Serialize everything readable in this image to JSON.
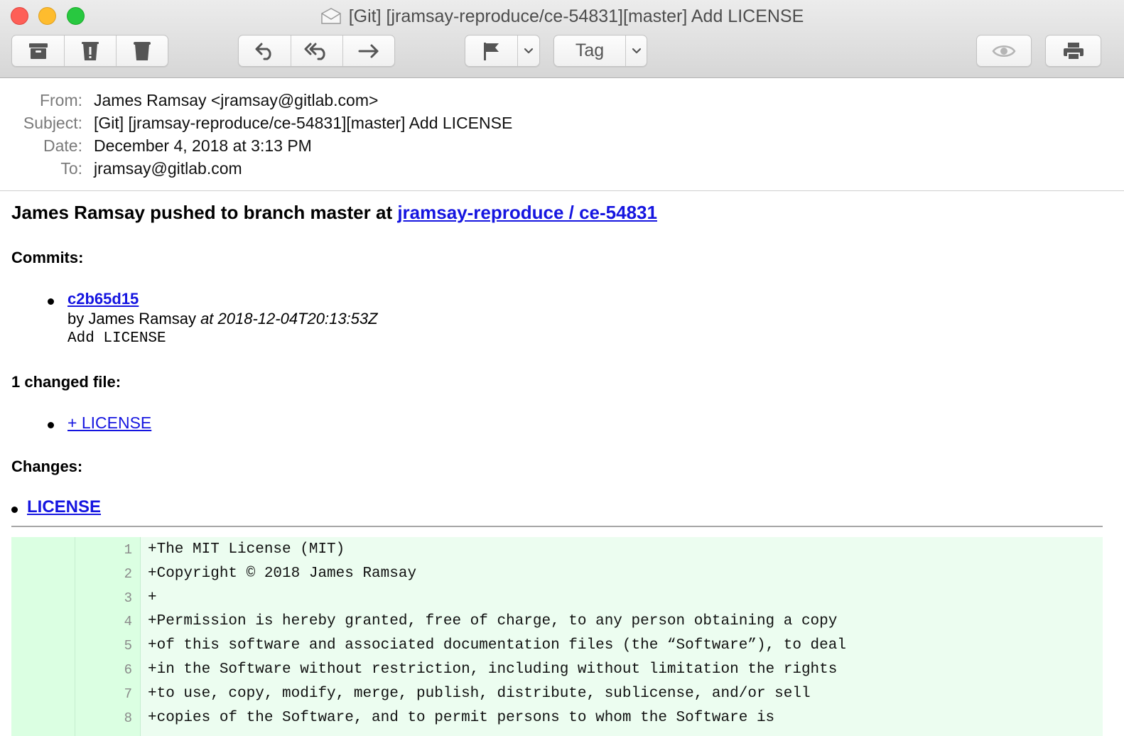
{
  "window": {
    "title": "[Git] [jramsay-reproduce/ce-54831][master] Add LICENSE"
  },
  "toolbar": {
    "tag_label": "Tag",
    "buttons": [
      "archive-icon",
      "junk-icon",
      "trash-icon",
      "reply-icon",
      "reply-all-icon",
      "forward-icon",
      "flag-icon",
      "chevron-down-icon",
      "tag-chevron-icon",
      "eye-icon",
      "print-icon"
    ]
  },
  "headers": {
    "from_label": "From:",
    "from_value": "James Ramsay <jramsay@gitlab.com>",
    "subject_label": "Subject:",
    "subject_value": "[Git] [jramsay-reproduce/ce-54831][master] Add LICENSE",
    "date_label": "Date:",
    "date_value": "December 4, 2018 at 3:13 PM",
    "to_label": "To:",
    "to_value": "jramsay@gitlab.com"
  },
  "body": {
    "headline_prefix": "James Ramsay pushed to branch master at ",
    "headline_link": "jramsay-reproduce / ce-54831",
    "commits_heading": "Commits:",
    "commit": {
      "sha": "c2b65d15",
      "by_prefix": "by James Ramsay ",
      "at_text": "at 2018-12-04T20:13:53Z",
      "message": "Add LICENSE"
    },
    "changed_heading": "1 changed file:",
    "changed_file": "+ LICENSE",
    "changes_heading": "Changes:",
    "changes_file": "LICENSE"
  },
  "diff": {
    "lines": [
      {
        "num": "1",
        "text": "+The MIT License (MIT)"
      },
      {
        "num": "2",
        "text": "+Copyright © 2018 James Ramsay"
      },
      {
        "num": "3",
        "text": "+"
      },
      {
        "num": "4",
        "text": "+Permission is hereby granted, free of charge, to any person obtaining a copy"
      },
      {
        "num": "5",
        "text": "+of this software and associated documentation files (the “Software”), to deal"
      },
      {
        "num": "6",
        "text": "+in the Software without restriction, including without limitation the rights"
      },
      {
        "num": "7",
        "text": "+to use, copy, modify, merge, publish, distribute, sublicense, and/or sell"
      },
      {
        "num": "8",
        "text": "+copies of the Software, and to permit persons to whom the Software is"
      }
    ]
  },
  "colors": {
    "link": "#1515e0",
    "diff_bg": "#ecfdf0",
    "diff_gutter": "#dbffe2"
  }
}
